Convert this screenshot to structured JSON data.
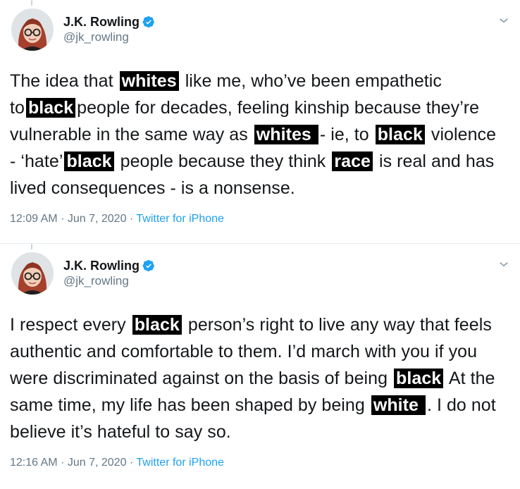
{
  "tweets": [
    {
      "display_name": "J.K. Rowling",
      "handle": "@jk_rowling",
      "body": [
        {
          "t": "The idea that "
        },
        {
          "t": "whites",
          "hl": true
        },
        {
          "t": " like me, who’ve been empathetic to"
        },
        {
          "t": "black",
          "hl": true
        },
        {
          "t": "people for decades, feeling kinship because they’re vulnerable in the same way as "
        },
        {
          "t": "whites ",
          "hl": true
        },
        {
          "t": " - ie, to "
        },
        {
          "t": "black",
          "hl": true
        },
        {
          "t": " violence - ‘hate’"
        },
        {
          "t": "black",
          "hl": true
        },
        {
          "t": " people because they think "
        },
        {
          "t": "race",
          "hl": true
        },
        {
          "t": " is real and has lived consequences - is a nonsense."
        }
      ],
      "time": "12:09 AM",
      "date": "Jun 7, 2020",
      "source": "Twitter for iPhone"
    },
    {
      "display_name": "J.K. Rowling",
      "handle": "@jk_rowling",
      "body": [
        {
          "t": "I respect every "
        },
        {
          "t": "black",
          "hl": true
        },
        {
          "t": " person’s right to live any way that feels authentic and comfortable to them. I’d march with you if you were discriminated against on the basis of being "
        },
        {
          "t": "black",
          "hl": true
        },
        {
          "t": " At the same time, my life has been shaped by being "
        },
        {
          "t": "white ",
          "hl": true
        },
        {
          "t": ". I do not believe it’s hateful to say so."
        }
      ],
      "time": "12:16 AM",
      "date": "Jun 7, 2020",
      "source": "Twitter for iPhone"
    }
  ],
  "icons": {
    "verified": "verified-badge-icon",
    "caret": "chevron-down-icon"
  },
  "colors": {
    "verified": "#1da1f2",
    "link": "#1da1f2",
    "muted": "#657786"
  }
}
